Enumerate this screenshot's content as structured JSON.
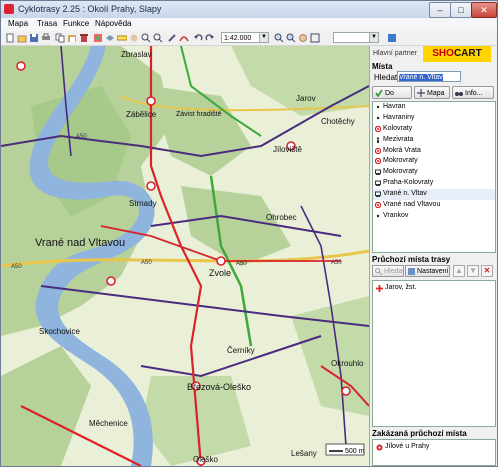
{
  "window": {
    "title": "Cyklotrasy 2.25 : Okolí Prahy, Slapy",
    "controls": [
      "–",
      "□",
      "✕"
    ]
  },
  "menu": [
    "Mapa",
    "Trasa",
    "Funkce",
    "Nápověda"
  ],
  "toolbar": {
    "scale": "1:42.000",
    "icons": [
      "new-icon",
      "open-icon",
      "save-icon",
      "print-icon",
      "copy-icon",
      "paste-icon",
      "trash-icon",
      "measure-icon",
      "layers-icon",
      "undo-icon",
      "redo-icon",
      "zoom-in-icon",
      "zoom-out-icon",
      "hand-icon",
      "ruler-icon",
      "book-icon"
    ]
  },
  "map": {
    "labels": [
      "Zbraslav",
      "Zábělice",
      "Závist hradiště",
      "Strnady",
      "Jíloviště",
      "Vrané nad Vltavou",
      "Ohrobec",
      "Zvole",
      "Skochovice",
      "Černíky",
      "Okrouhlo",
      "Březová-Oleško",
      "Měchenice",
      "Oleško",
      "Lešany",
      "Jarov",
      "Chotěchy"
    ],
    "road_labels": [
      "A50",
      "A50",
      "A50",
      "A50",
      "A50"
    ],
    "scale_bar": "500 m",
    "colors": {
      "forest": "#a7c98a",
      "field": "#eaf0d8",
      "river": "#8fb4dd",
      "route_red": "#d8232a",
      "route_purple": "#4b2b7e",
      "road_green": "#3ea83a"
    }
  },
  "panel": {
    "partner_label": "Hlavní partner",
    "logo_part1": "SHO",
    "logo_part2": "CART",
    "places_title": "Místa",
    "find_label": "Hledat",
    "find_value_prefix": "",
    "find_value_selected": "Vrané n. Vltav",
    "btn_to_route": "Do trasy",
    "btn_map": "Mapa",
    "btn_info": "Info...",
    "places": [
      {
        "name": "Havran",
        "icon": "dot"
      },
      {
        "name": "Havraniny",
        "icon": "dot"
      },
      {
        "name": "Kolovraty",
        "icon": "circle"
      },
      {
        "name": "Mezivrata",
        "icon": "person"
      },
      {
        "name": "Mokrá Vrata",
        "icon": "circle"
      },
      {
        "name": "Mokrovraty",
        "icon": "circle"
      },
      {
        "name": "Mokrovraty",
        "icon": "train"
      },
      {
        "name": "Praha-Kolovraty",
        "icon": "train"
      },
      {
        "name": "Vrané n. Vltav",
        "icon": "train"
      },
      {
        "name": "Vrané nad Vltavou",
        "icon": "circle"
      },
      {
        "name": "Vrankov",
        "icon": "dot"
      }
    ],
    "waypoints_title": "Průchozí místa trasy",
    "wp_btn_find": "Hledat",
    "wp_btn_settings": "Nastavení",
    "waypoints": [
      "Jarov, žst."
    ],
    "forbidden_title": "Zakázaná průchozí místa",
    "forbidden": [
      "Jílové u Prahy"
    ]
  }
}
